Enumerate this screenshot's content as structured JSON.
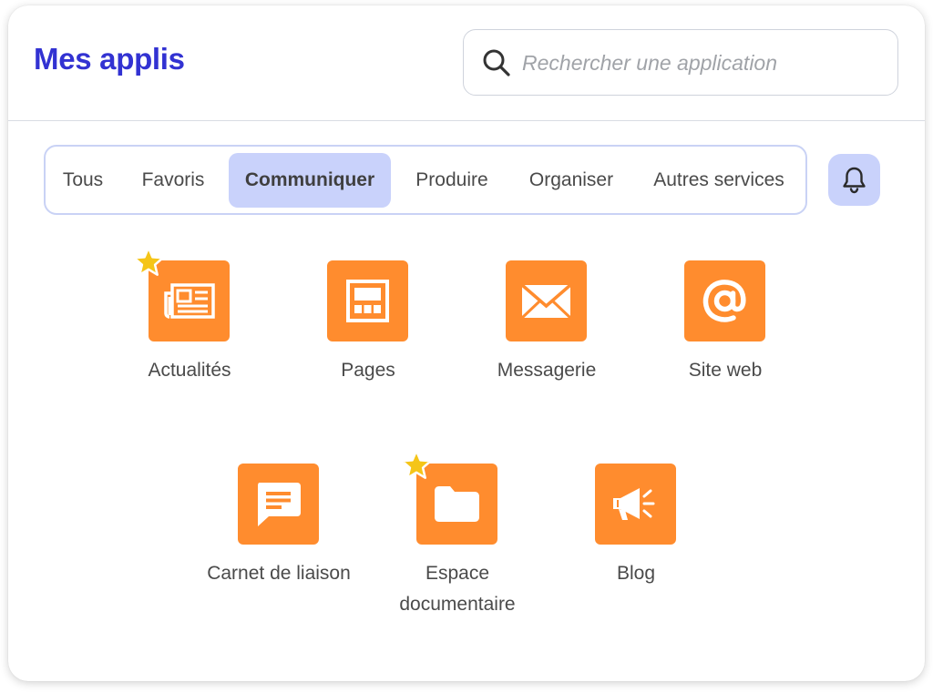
{
  "header": {
    "title": "Mes applis",
    "search_placeholder": "Rechercher une application"
  },
  "tabs": [
    {
      "label": "Tous",
      "active": false
    },
    {
      "label": "Favoris",
      "active": false
    },
    {
      "label": "Communiquer",
      "active": true
    },
    {
      "label": "Produire",
      "active": false
    },
    {
      "label": "Organiser",
      "active": false
    },
    {
      "label": "Autres services",
      "active": false
    }
  ],
  "notifications": {
    "icon": "bell-icon"
  },
  "apps": [
    {
      "label": "Actualités",
      "icon": "newspaper-icon",
      "favorite": true
    },
    {
      "label": "Pages",
      "icon": "pages-icon",
      "favorite": false
    },
    {
      "label": "Messagerie",
      "icon": "envelope-icon",
      "favorite": false
    },
    {
      "label": "Site web",
      "icon": "at-sign-icon",
      "favorite": false
    },
    {
      "label": "Carnet de liaison",
      "icon": "message-icon",
      "favorite": false
    },
    {
      "label": "Espace documentaire",
      "icon": "folder-icon",
      "favorite": true
    },
    {
      "label": "Blog",
      "icon": "megaphone-icon",
      "favorite": false
    }
  ],
  "colors": {
    "brand": "#3232d2",
    "tile": "#ff8c2e",
    "active_tab": "#c9d2fb",
    "star": "#f5c518"
  }
}
